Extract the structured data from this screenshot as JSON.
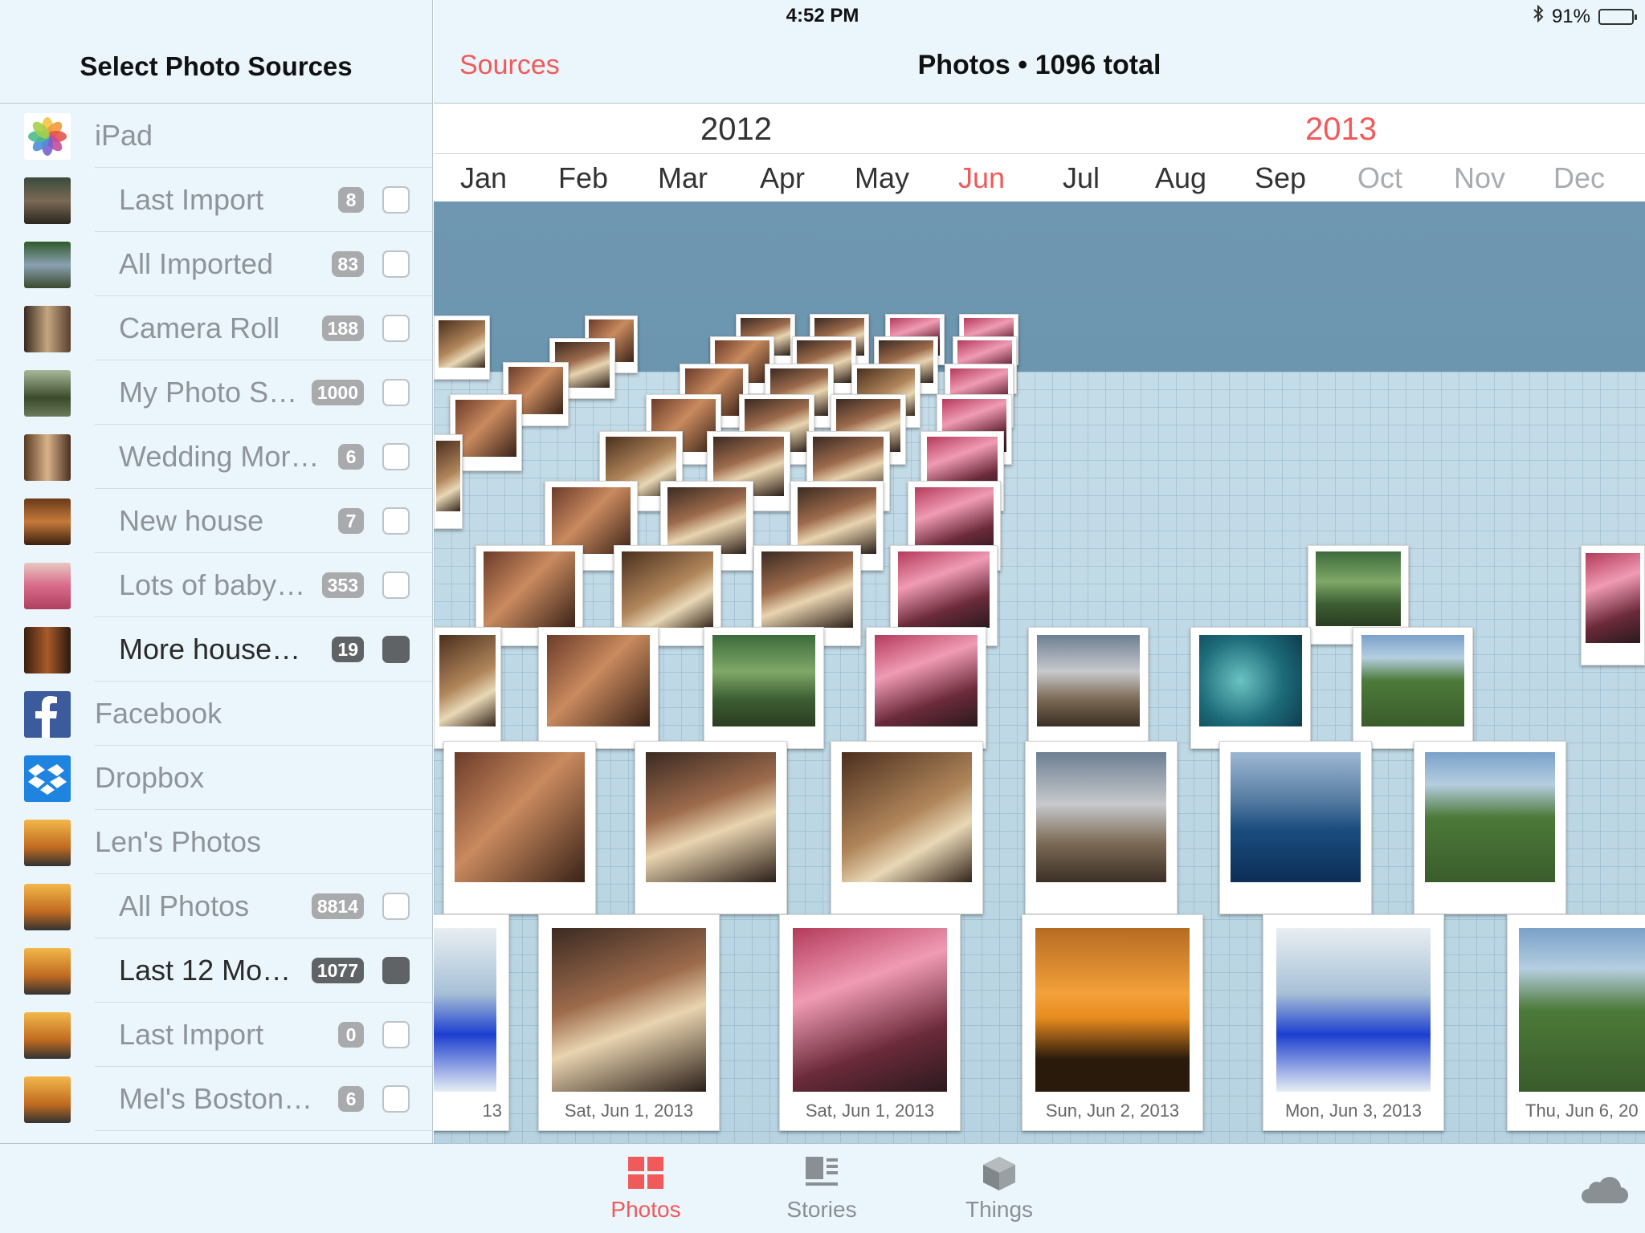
{
  "status_bar": {
    "time": "4:52 PM",
    "battery": "91%"
  },
  "sidebar": {
    "title": "Select Photo Sources",
    "items": [
      {
        "label": "iPad",
        "kind": "top",
        "icon": "photos-app-icon"
      },
      {
        "label": "Last Import",
        "count": "8",
        "kind": "sub",
        "checked": false
      },
      {
        "label": "All Imported",
        "count": "83",
        "kind": "sub",
        "checked": false
      },
      {
        "label": "Camera Roll",
        "count": "188",
        "kind": "sub",
        "checked": false
      },
      {
        "label": "My Photo S…",
        "count": "1000",
        "kind": "sub",
        "checked": false
      },
      {
        "label": "Wedding Mor…",
        "count": "6",
        "kind": "sub",
        "checked": false
      },
      {
        "label": "New house",
        "count": "7",
        "kind": "sub",
        "checked": false
      },
      {
        "label": "Lots of baby…",
        "count": "353",
        "kind": "sub",
        "checked": false
      },
      {
        "label": "More house…",
        "count": "19",
        "kind": "sub",
        "checked": true
      },
      {
        "label": "Facebook",
        "kind": "top",
        "icon": "facebook-icon"
      },
      {
        "label": "Dropbox",
        "kind": "top",
        "icon": "dropbox-icon"
      },
      {
        "label": "Len's Photos",
        "kind": "top",
        "icon": "iphoto-icon"
      },
      {
        "label": "All Photos",
        "count": "8814",
        "kind": "sub",
        "checked": false
      },
      {
        "label": "Last 12 Mo…",
        "count": "1077",
        "kind": "sub",
        "checked": true
      },
      {
        "label": "Last Import",
        "count": "0",
        "kind": "sub",
        "checked": false
      },
      {
        "label": "Mel's Boston…",
        "count": "6",
        "kind": "sub",
        "checked": false
      }
    ]
  },
  "nav": {
    "sources_label": "Sources",
    "title": "Photos • 1096 total"
  },
  "timeline": {
    "years": [
      "2012",
      "2013"
    ],
    "months": [
      "Jan",
      "Feb",
      "Mar",
      "Apr",
      "May",
      "Jun",
      "Jul",
      "Aug",
      "Sep",
      "Oct",
      "Nov",
      "Dec"
    ],
    "current_month": "Jun"
  },
  "photos": {
    "captions": [
      "Sat, Jun 1, 2013",
      "Sat, Jun 1, 2013",
      "Sun, Jun 2, 2013",
      "Mon, Jun 3, 2013",
      "Thu, Jun 6, 20",
      "13"
    ]
  },
  "tabs": [
    {
      "label": "Photos",
      "active": true
    },
    {
      "label": "Stories",
      "active": false
    },
    {
      "label": "Things",
      "active": false
    }
  ],
  "colors": {
    "accent": "#f15a5a",
    "sidebar_bg": "#eaf6fb",
    "stage_sky": "#6f97b1",
    "floor": "#c4dce8"
  }
}
